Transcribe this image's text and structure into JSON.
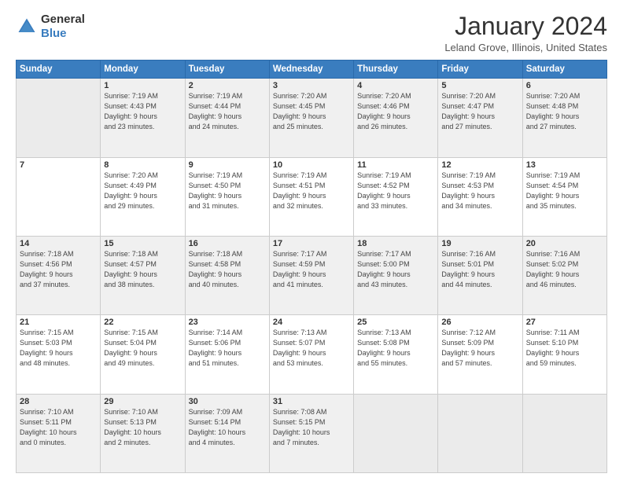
{
  "header": {
    "logo_general": "General",
    "logo_blue": "Blue",
    "month_year": "January 2024",
    "location": "Leland Grove, Illinois, United States"
  },
  "weekdays": [
    "Sunday",
    "Monday",
    "Tuesday",
    "Wednesday",
    "Thursday",
    "Friday",
    "Saturday"
  ],
  "weeks": [
    [
      {
        "day": "",
        "info": ""
      },
      {
        "day": "1",
        "info": "Sunrise: 7:19 AM\nSunset: 4:43 PM\nDaylight: 9 hours\nand 23 minutes."
      },
      {
        "day": "2",
        "info": "Sunrise: 7:19 AM\nSunset: 4:44 PM\nDaylight: 9 hours\nand 24 minutes."
      },
      {
        "day": "3",
        "info": "Sunrise: 7:20 AM\nSunset: 4:45 PM\nDaylight: 9 hours\nand 25 minutes."
      },
      {
        "day": "4",
        "info": "Sunrise: 7:20 AM\nSunset: 4:46 PM\nDaylight: 9 hours\nand 26 minutes."
      },
      {
        "day": "5",
        "info": "Sunrise: 7:20 AM\nSunset: 4:47 PM\nDaylight: 9 hours\nand 27 minutes."
      },
      {
        "day": "6",
        "info": "Sunrise: 7:20 AM\nSunset: 4:48 PM\nDaylight: 9 hours\nand 27 minutes."
      }
    ],
    [
      {
        "day": "7",
        "info": ""
      },
      {
        "day": "8",
        "info": "Sunrise: 7:20 AM\nSunset: 4:49 PM\nDaylight: 9 hours\nand 29 minutes."
      },
      {
        "day": "9",
        "info": "Sunrise: 7:19 AM\nSunset: 4:50 PM\nDaylight: 9 hours\nand 31 minutes."
      },
      {
        "day": "10",
        "info": "Sunrise: 7:19 AM\nSunset: 4:51 PM\nDaylight: 9 hours\nand 32 minutes."
      },
      {
        "day": "11",
        "info": "Sunrise: 7:19 AM\nSunset: 4:52 PM\nDaylight: 9 hours\nand 33 minutes."
      },
      {
        "day": "12",
        "info": "Sunrise: 7:19 AM\nSunset: 4:53 PM\nDaylight: 9 hours\nand 34 minutes."
      },
      {
        "day": "13",
        "info": "Sunrise: 7:19 AM\nSunset: 4:54 PM\nDaylight: 9 hours\nand 35 minutes."
      }
    ],
    [
      {
        "day": "14",
        "info": "Sunrise: 7:18 AM\nSunset: 4:56 PM\nDaylight: 9 hours\nand 37 minutes."
      },
      {
        "day": "15",
        "info": "Sunrise: 7:18 AM\nSunset: 4:57 PM\nDaylight: 9 hours\nand 38 minutes."
      },
      {
        "day": "16",
        "info": "Sunrise: 7:18 AM\nSunset: 4:58 PM\nDaylight: 9 hours\nand 40 minutes."
      },
      {
        "day": "17",
        "info": "Sunrise: 7:17 AM\nSunset: 4:59 PM\nDaylight: 9 hours\nand 41 minutes."
      },
      {
        "day": "18",
        "info": "Sunrise: 7:17 AM\nSunset: 5:00 PM\nDaylight: 9 hours\nand 43 minutes."
      },
      {
        "day": "19",
        "info": "Sunrise: 7:16 AM\nSunset: 5:01 PM\nDaylight: 9 hours\nand 44 minutes."
      },
      {
        "day": "20",
        "info": "Sunrise: 7:16 AM\nSunset: 5:02 PM\nDaylight: 9 hours\nand 46 minutes."
      }
    ],
    [
      {
        "day": "21",
        "info": "Sunrise: 7:15 AM\nSunset: 5:03 PM\nDaylight: 9 hours\nand 48 minutes."
      },
      {
        "day": "22",
        "info": "Sunrise: 7:15 AM\nSunset: 5:04 PM\nDaylight: 9 hours\nand 49 minutes."
      },
      {
        "day": "23",
        "info": "Sunrise: 7:14 AM\nSunset: 5:06 PM\nDaylight: 9 hours\nand 51 minutes."
      },
      {
        "day": "24",
        "info": "Sunrise: 7:13 AM\nSunset: 5:07 PM\nDaylight: 9 hours\nand 53 minutes."
      },
      {
        "day": "25",
        "info": "Sunrise: 7:13 AM\nSunset: 5:08 PM\nDaylight: 9 hours\nand 55 minutes."
      },
      {
        "day": "26",
        "info": "Sunrise: 7:12 AM\nSunset: 5:09 PM\nDaylight: 9 hours\nand 57 minutes."
      },
      {
        "day": "27",
        "info": "Sunrise: 7:11 AM\nSunset: 5:10 PM\nDaylight: 9 hours\nand 59 minutes."
      }
    ],
    [
      {
        "day": "28",
        "info": "Sunrise: 7:10 AM\nSunset: 5:11 PM\nDaylight: 10 hours\nand 0 minutes."
      },
      {
        "day": "29",
        "info": "Sunrise: 7:10 AM\nSunset: 5:13 PM\nDaylight: 10 hours\nand 2 minutes."
      },
      {
        "day": "30",
        "info": "Sunrise: 7:09 AM\nSunset: 5:14 PM\nDaylight: 10 hours\nand 4 minutes."
      },
      {
        "day": "31",
        "info": "Sunrise: 7:08 AM\nSunset: 5:15 PM\nDaylight: 10 hours\nand 7 minutes."
      },
      {
        "day": "",
        "info": ""
      },
      {
        "day": "",
        "info": ""
      },
      {
        "day": "",
        "info": ""
      }
    ]
  ]
}
